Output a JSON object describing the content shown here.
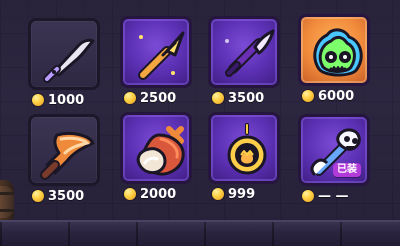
{
  "shop": {
    "items": [
      {
        "price": "1000",
        "icon": "knife-icon"
      },
      {
        "price": "2500",
        "icon": "golden-spear-icon"
      },
      {
        "price": "3500",
        "icon": "purple-dagger-icon"
      },
      {
        "price": "6000",
        "icon": "green-flame-mask-icon"
      },
      {
        "price": "3500",
        "icon": "flame-cleaver-icon"
      },
      {
        "price": "2000",
        "icon": "meat-club-icon"
      },
      {
        "price": "999",
        "icon": "golden-amulet-icon"
      },
      {
        "price": "— —",
        "icon": "skull-hammer-icon",
        "badge": "已装"
      }
    ]
  },
  "colors": {
    "locked_tile": "#342e4a",
    "unlocked_tile": "#5a2fb1",
    "selected_tile": "#f08a3b",
    "badge": "#b13bd9",
    "coin": "#ffd348"
  }
}
